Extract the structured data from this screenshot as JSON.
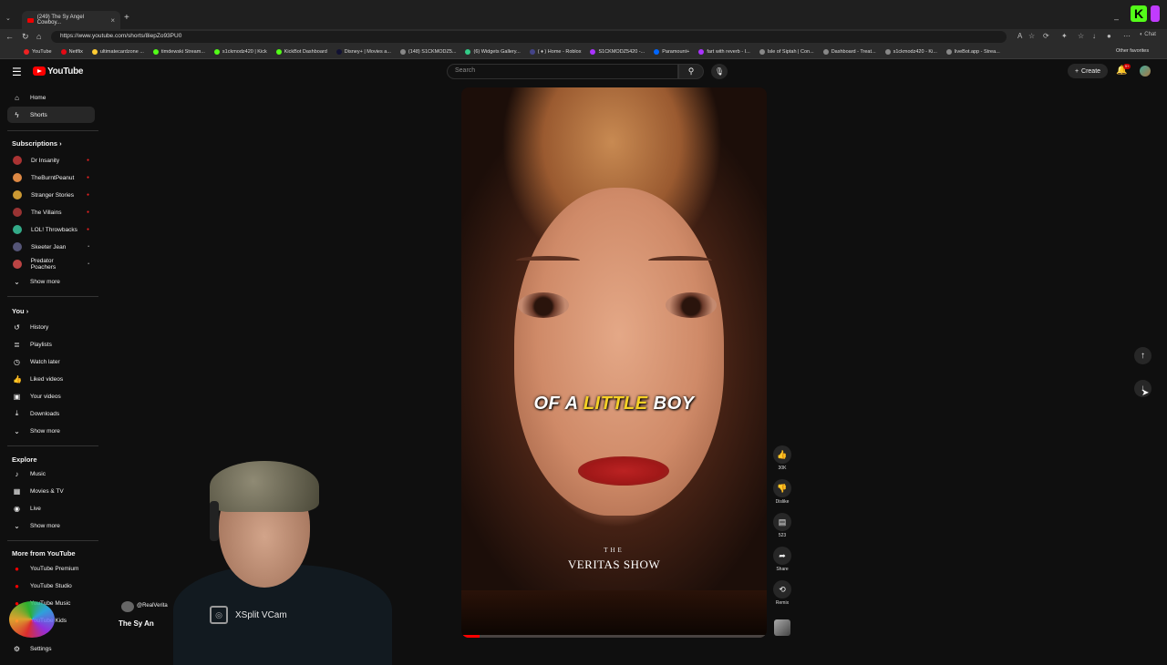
{
  "browser": {
    "tab_title": "(249) The Sy Angel Cowboy...",
    "url": "https://www.youtube.com/shorts/8iepZo93PU0",
    "bookmarks": [
      "YouTube",
      "Netflix",
      "ultimatecardzone ...",
      "timdewski Stream...",
      "s1ckmodz420 | Kick",
      "KickBot Dashboard",
      "Disney+ | Movies a...",
      "(148) S1CKMODZ5...",
      "(6) Widgets Gallery...",
      "( ♦ ) Home - Roblox",
      "S1CKMODZ5420 -...",
      "Paramount+",
      "fart with reverb - I...",
      "Isle of Siptah | Con...",
      "Dashboard - Treat...",
      "s1ckmodz420 - Ki...",
      "liveBot.app - Strea..."
    ],
    "other_favorites": "Other favorites"
  },
  "header": {
    "logo_text": "YouTube",
    "search_placeholder": "Search",
    "create_label": "Create",
    "notif_count": "9+"
  },
  "sidebar": {
    "home": "Home",
    "shorts": "Shorts",
    "subscriptions": "Subscriptions",
    "channels": [
      {
        "name": "Dr Insanity",
        "color": "#a33"
      },
      {
        "name": "TheBurntPeanut",
        "color": "#d84"
      },
      {
        "name": "Stranger Stories",
        "color": "#c93"
      },
      {
        "name": "The Villains",
        "color": "#933"
      },
      {
        "name": "LOL! Throwbacks",
        "color": "#3a8"
      },
      {
        "name": "Skeeter Jean",
        "color": "#557"
      },
      {
        "name": "Predator Poachers",
        "color": "#b44"
      }
    ],
    "show_more": "Show more",
    "you": "You",
    "you_items": [
      "History",
      "Playlists",
      "Watch later",
      "Liked videos",
      "Your videos",
      "Downloads"
    ],
    "explore": "Explore",
    "explore_items": [
      "Music",
      "Movies & TV",
      "Live"
    ],
    "more_from": "More from YouTube",
    "more_items": [
      "YouTube Premium",
      "YouTube Studio",
      "YouTube Music",
      "YouTube Kids"
    ],
    "settings": "Settings"
  },
  "video": {
    "caption_pre": "OF A ",
    "caption_highlight": "LITTLE",
    "caption_post": " BOY",
    "brand_small": "THE",
    "brand": "VERITAS SHOW",
    "progress": 0.06,
    "channel_handle": "@RealVerita",
    "title": "The Sy An"
  },
  "actions": {
    "likes": "30K",
    "dislike": "Dislike",
    "comments": "523",
    "share": "Share",
    "remix": "Remix"
  },
  "overlay": {
    "vcam_label": "XSplit VCam"
  }
}
